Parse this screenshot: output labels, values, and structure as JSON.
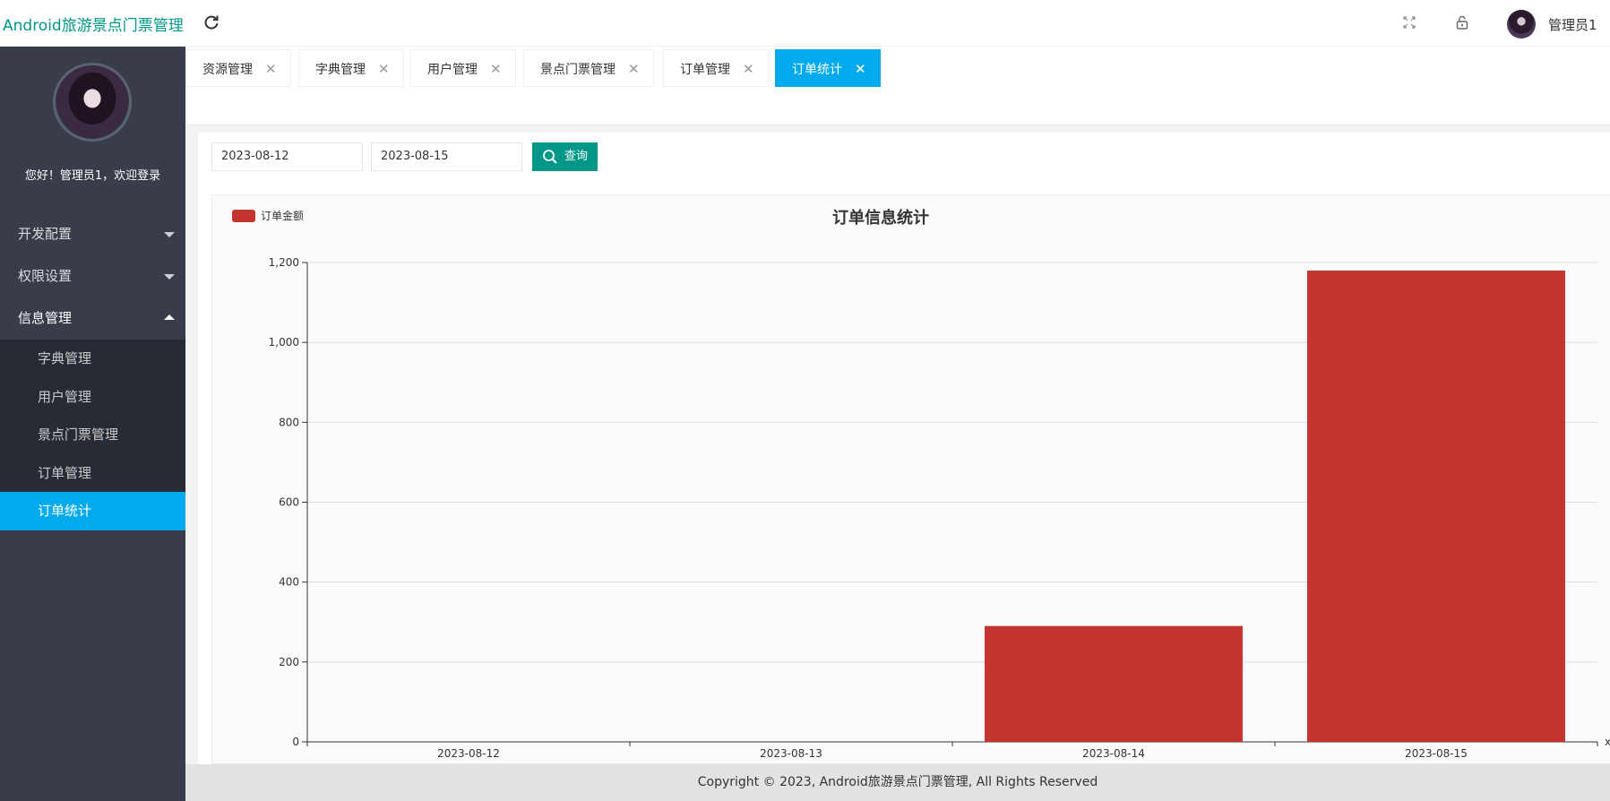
{
  "app": {
    "title": "Android旅游景点门票管理",
    "admin_name": "管理员1"
  },
  "icons": {
    "refresh": "refresh-icon",
    "fullscreen": "fullscreen-icon",
    "lock": "lock-icon"
  },
  "sidebar": {
    "welcome": "您好！管理员1，欢迎登录",
    "menus": [
      {
        "label": "开发配置",
        "open": false
      },
      {
        "label": "权限设置",
        "open": false
      },
      {
        "label": "信息管理",
        "open": true
      }
    ],
    "sub_items": [
      {
        "label": "字典管理",
        "active": false
      },
      {
        "label": "用户管理",
        "active": false
      },
      {
        "label": "景点门票管理",
        "active": false
      },
      {
        "label": "订单管理",
        "active": false
      },
      {
        "label": "订单统计",
        "active": true
      }
    ]
  },
  "tabs": [
    {
      "label": "资源管理",
      "active": false
    },
    {
      "label": "字典管理",
      "active": false
    },
    {
      "label": "用户管理",
      "active": false
    },
    {
      "label": "景点门票管理",
      "active": false
    },
    {
      "label": "订单管理",
      "active": false
    },
    {
      "label": "订单统计",
      "active": true
    }
  ],
  "filters": {
    "start_date": "2023-08-12",
    "end_date": "2023-08-15",
    "query_label": "查询"
  },
  "colors": {
    "accent": "#009688",
    "active_tab": "#01aaed",
    "bar": "#c23531",
    "sidebar": "#393d49"
  },
  "chart_data": {
    "type": "bar",
    "title": "订单信息统计",
    "categories": [
      "2023-08-12",
      "2023-08-13",
      "2023-08-14",
      "2023-08-15"
    ],
    "series": [
      {
        "name": "订单金额",
        "values": [
          0,
          0,
          290,
          1180
        ]
      }
    ],
    "xlabel": "x",
    "ylabel": "",
    "ylim": [
      0,
      1200
    ],
    "yticks": [
      0,
      200,
      400,
      600,
      800,
      1000,
      1200
    ],
    "ytick_labels": [
      "0",
      "200",
      "400",
      "600",
      "800",
      "1,000",
      "1,200"
    ],
    "grid": true,
    "legend_position": "top-left"
  },
  "footer": {
    "text": "Copyright © 2023, Android旅游景点门票管理, All Rights Reserved"
  }
}
